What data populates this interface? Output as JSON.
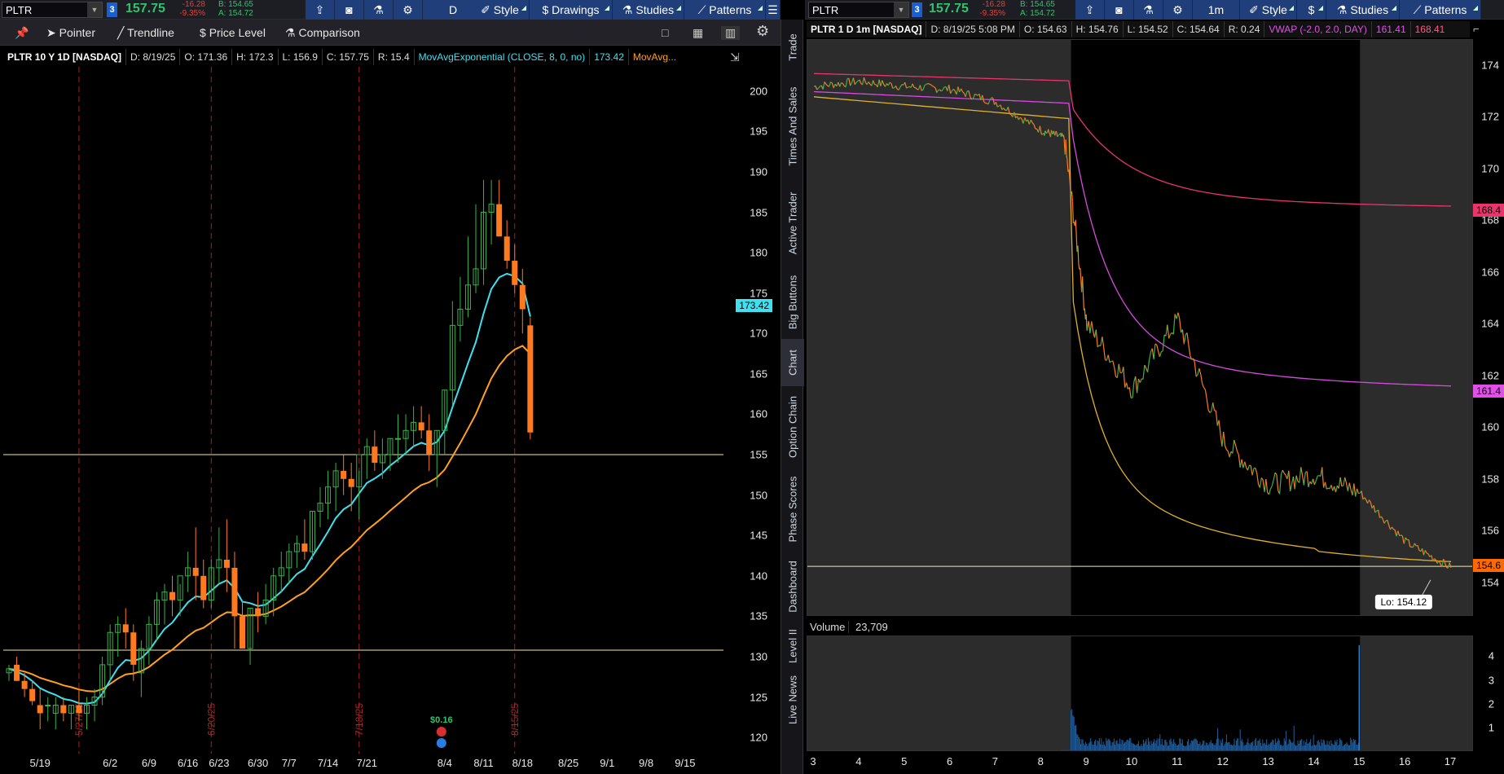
{
  "left": {
    "symbol": "PLTR",
    "link": "3",
    "last": "157.75",
    "change": "-16.28",
    "change_pct": "-9.35%",
    "bid": "B: 154.65",
    "ask": "A: 154.72",
    "toolbar": {
      "period": "D",
      "style": "Style",
      "drawings": "Drawings",
      "studies": "Studies",
      "patterns": "Patterns"
    },
    "tools": {
      "pointer": "Pointer",
      "trendline": "Trendline",
      "price_level": "Price Level",
      "comparison": "Comparison"
    },
    "info": {
      "title": "PLTR 10 Y 1D [NASDAQ]",
      "date": "D: 8/19/25",
      "open": "O: 171.36",
      "high": "H: 172.3",
      "low": "L: 156.9",
      "close": "C: 157.75",
      "range": "R: 15.4",
      "study": "MovAvgExponential (CLOSE, 8, 0, no)",
      "study_value": "173.42",
      "study2": "MovAvg..."
    },
    "yticks": [
      "200",
      "195",
      "190",
      "185",
      "180",
      "175",
      "170",
      "165",
      "160",
      "155",
      "150",
      "145",
      "140",
      "135",
      "130",
      "125",
      "120"
    ],
    "xticks": [
      "5/19",
      "6/2",
      "6/9",
      "6/16",
      "6/23",
      "6/30",
      "7/7",
      "7/14",
      "7/21",
      "8/4",
      "8/11",
      "8/18",
      "8/25",
      "9/1",
      "9/8",
      "9/15"
    ],
    "vmarkers": [
      "5/27/25",
      "6/20/25",
      "7/18/25",
      "8/15/25"
    ],
    "ema_tag": "173.42",
    "dividend": "$0.16",
    "colors": {
      "up": "#38b24a",
      "down": "#ff7a1e",
      "ema8": "#3fe0f0",
      "ema21": "#ffa020",
      "hline": "#f4e9a8"
    }
  },
  "right": {
    "symbol": "PLTR",
    "link": "3",
    "last": "157.75",
    "change": "-16.28",
    "change_pct": "-9.35%",
    "bid": "B: 154.65",
    "ask": "A: 154.72",
    "toolbar": {
      "period": "1m",
      "style": "Style",
      "studies": "Studies",
      "patterns": "Patterns"
    },
    "info": {
      "title": "PLTR 1 D 1m [NASDAQ]",
      "date": "D: 8/19/25 5:08 PM",
      "open": "O: 154.63",
      "high": "H: 154.76",
      "low": "L: 154.52",
      "close": "C: 154.64",
      "range": "R: 0.24",
      "study": "VWAP (-2.0, 2.0, DAY)",
      "v1": "161.41",
      "v2": "168.41"
    },
    "yticks": [
      "174",
      "172",
      "170",
      "168",
      "166",
      "164",
      "162",
      "160",
      "158",
      "156",
      "154"
    ],
    "xticks": [
      "3",
      "4",
      "5",
      "6",
      "7",
      "8",
      "9",
      "10",
      "11",
      "12",
      "13",
      "14",
      "15",
      "16",
      "17"
    ],
    "tags": {
      "upper": "168.4",
      "vwap": "161.4",
      "last": "154.6"
    },
    "lo_label": "Lo: 154.12",
    "volume_label": "Volume",
    "volume_value": "23,709",
    "vol_ticks": [
      "4",
      "3",
      "2",
      "1"
    ]
  },
  "sidetabs": [
    "Trade",
    "Times And Sales",
    "Active Trader",
    "Big Buttons",
    "Chart",
    "Option Chain",
    "Phase Scores",
    "Dashboard",
    "Level II",
    "Live News"
  ],
  "chart_data": [
    {
      "type": "candlestick",
      "title": "PLTR 10 Y 1D [NASDAQ]",
      "ylim": [
        118,
        203
      ],
      "dates": [
        "5/13",
        "5/14",
        "5/15",
        "5/16",
        "5/19",
        "5/20",
        "5/21",
        "5/22",
        "5/23",
        "5/27",
        "5/28",
        "5/29",
        "5/30",
        "6/2",
        "6/3",
        "6/4",
        "6/5",
        "6/6",
        "6/9",
        "6/10",
        "6/11",
        "6/12",
        "6/13",
        "6/16",
        "6/17",
        "6/18",
        "6/20",
        "6/23",
        "6/24",
        "6/25",
        "6/26",
        "6/27",
        "6/30",
        "7/1",
        "7/2",
        "7/3",
        "7/7",
        "7/8",
        "7/9",
        "7/10",
        "7/11",
        "7/14",
        "7/15",
        "7/16",
        "7/17",
        "7/18",
        "7/21",
        "7/22",
        "7/23",
        "7/24",
        "7/25",
        "7/28",
        "7/29",
        "7/30",
        "7/31",
        "8/1",
        "8/4",
        "8/5",
        "8/6",
        "8/7",
        "8/8",
        "8/11",
        "8/12",
        "8/13",
        "8/14",
        "8/15",
        "8/18",
        "8/19"
      ],
      "open": [
        128,
        129,
        127,
        126,
        124,
        124,
        123,
        124,
        123,
        124,
        123,
        124,
        125,
        129,
        133,
        134,
        133,
        128,
        131,
        134,
        137,
        138,
        137,
        140,
        141,
        140,
        137,
        141,
        142,
        141,
        135,
        131,
        136,
        135,
        137,
        140,
        141,
        143,
        144,
        143,
        148,
        149,
        151,
        153,
        152,
        151,
        155,
        156,
        154,
        155,
        157,
        157,
        158,
        159,
        158,
        155,
        158,
        163,
        171,
        173,
        176,
        178,
        185,
        186,
        182,
        179,
        176,
        171
      ],
      "high": [
        129,
        130,
        128,
        127,
        126,
        125,
        125,
        125,
        124,
        126,
        125,
        126,
        130,
        134,
        135,
        136,
        134,
        132,
        135,
        138,
        139,
        140,
        139,
        143,
        146,
        142,
        142,
        146,
        147,
        143,
        137,
        136,
        138,
        139,
        141,
        143,
        144,
        145,
        147,
        148,
        151,
        153,
        154,
        155,
        154,
        153,
        157,
        158,
        157,
        157,
        160,
        160,
        161,
        161,
        160,
        158,
        163,
        174,
        177,
        182,
        186,
        189,
        189,
        189,
        184,
        181,
        178,
        172
      ],
      "low": [
        127,
        127,
        125,
        124,
        121,
        122,
        121,
        122,
        121,
        122,
        121,
        122,
        124,
        127,
        130,
        131,
        127,
        125,
        129,
        132,
        134,
        135,
        135,
        138,
        137,
        136,
        136,
        139,
        138,
        131,
        131,
        129,
        133,
        134,
        135,
        138,
        139,
        141,
        142,
        142,
        146,
        147,
        148,
        150,
        148,
        147,
        152,
        153,
        152,
        153,
        154,
        155,
        156,
        157,
        153,
        151,
        155,
        161,
        169,
        172,
        175,
        176,
        181,
        183,
        178,
        175,
        170,
        156.9
      ],
      "close": [
        128.5,
        127,
        126,
        124.5,
        123,
        124,
        124,
        123,
        124,
        123,
        124,
        125,
        129,
        133,
        134,
        133,
        129,
        131,
        134,
        137,
        138,
        137,
        140,
        141,
        140,
        137,
        141,
        142,
        141,
        135,
        131,
        136,
        135,
        137,
        140,
        141,
        143,
        144,
        143,
        148,
        149,
        151,
        153,
        152,
        151,
        155,
        156,
        154,
        155,
        157,
        157,
        158,
        159,
        158,
        155,
        158,
        163,
        171,
        173,
        176,
        178,
        185,
        186,
        182,
        179,
        176,
        173,
        157.75
      ]
    },
    {
      "type": "line",
      "title": "PLTR 1 D 1m [NASDAQ]",
      "ylim": [
        152.7,
        175
      ],
      "x": [
        "3",
        "4",
        "5",
        "6",
        "7",
        "8",
        "8.5",
        "9",
        "10",
        "11",
        "12",
        "13",
        "14",
        "15",
        "16",
        "17"
      ],
      "series": [
        {
          "values": [
            173.2,
            173.4,
            173.2,
            173.1,
            172.6,
            171.5,
            171.2,
            164.0,
            161.5,
            164.2,
            159.5,
            157.8,
            158.2,
            157.5,
            155.6,
            154.6
          ]
        }
      ]
    }
  ]
}
